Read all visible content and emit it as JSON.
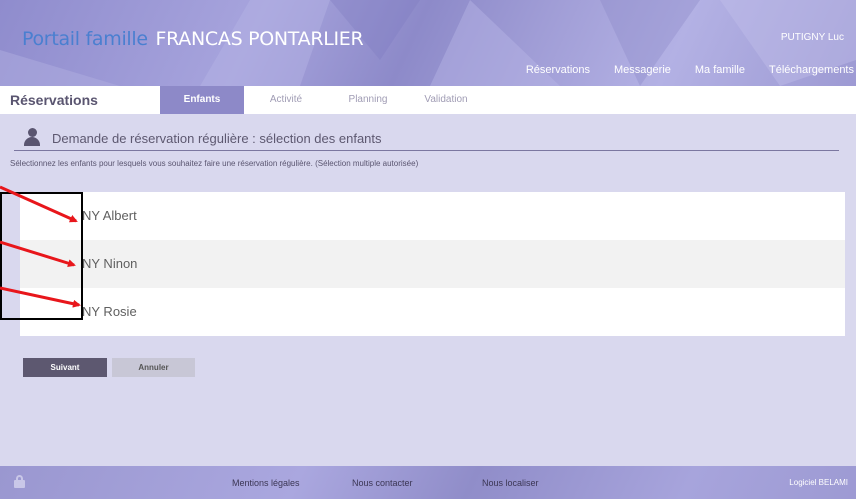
{
  "header": {
    "title": "Portail famille",
    "org": "FRANCAS PONTARLIER",
    "user": "PUTIGNY Luc",
    "nav": [
      "Réservations",
      "Messagerie",
      "Ma famille",
      "Téléchargements"
    ]
  },
  "tabsbar": {
    "section_title": "Réservations",
    "tabs": [
      {
        "label": "Enfants",
        "active": true
      },
      {
        "label": "Activité",
        "active": false
      },
      {
        "label": "Planning",
        "active": false
      },
      {
        "label": "Validation",
        "active": false
      }
    ]
  },
  "main": {
    "request_title": "Demande de réservation régulière : sélection des enfants",
    "instructions": "Sélectionnez les enfants pour lesquels vous souhaitez faire une réservation régulière. (Sélection multiple autorisée)",
    "children": [
      "NY Albert",
      "NY Ninon",
      "NY Rosie"
    ],
    "next_label": "Suivant",
    "cancel_label": "Annuler"
  },
  "footer": {
    "links": [
      "Mentions légales",
      "Nous contacter",
      "Nous localiser"
    ],
    "credit": "Logiciel BELAMI"
  },
  "colors": {
    "accent": "#8d89c8",
    "title_blue": "#4a7fd0",
    "button_dark": "#5d5870",
    "annotation_arrow": "#e8161b"
  }
}
